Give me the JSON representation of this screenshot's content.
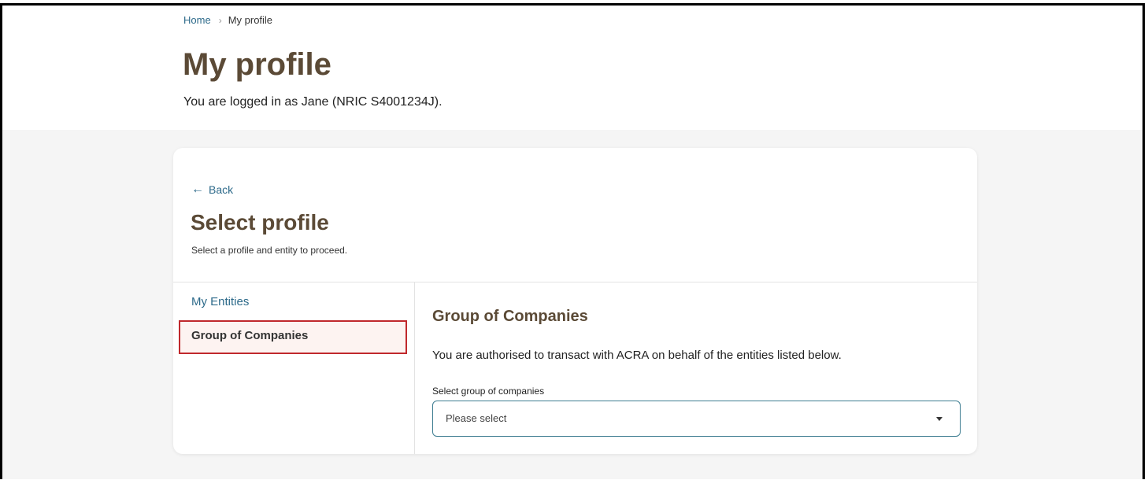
{
  "breadcrumb": {
    "home": "Home",
    "separator": "›",
    "current": "My profile"
  },
  "header": {
    "title": "My profile",
    "login_text": "You are logged in as Jane (NRIC S4001234J)."
  },
  "card": {
    "back_label": "Back",
    "back_icon": "arrow-left-icon",
    "title": "Select profile",
    "subtitle": "Select a profile and entity to proceed."
  },
  "sidebar": {
    "heading": "My Entities",
    "items": [
      {
        "label": "Group of Companies",
        "selected": true
      }
    ]
  },
  "content": {
    "title": "Group of Companies",
    "description": "You are authorised to transact with ACRA on behalf of the entities listed below.",
    "select_label": "Select group of companies",
    "select_placeholder": "Please select",
    "select_icon": "chevron-down-icon"
  },
  "colors": {
    "title": "#5b4a36",
    "link": "#2d6a8a",
    "selected_border": "#c0282c",
    "selected_bg": "#fdf3f1",
    "page_bg": "#f5f5f5"
  }
}
